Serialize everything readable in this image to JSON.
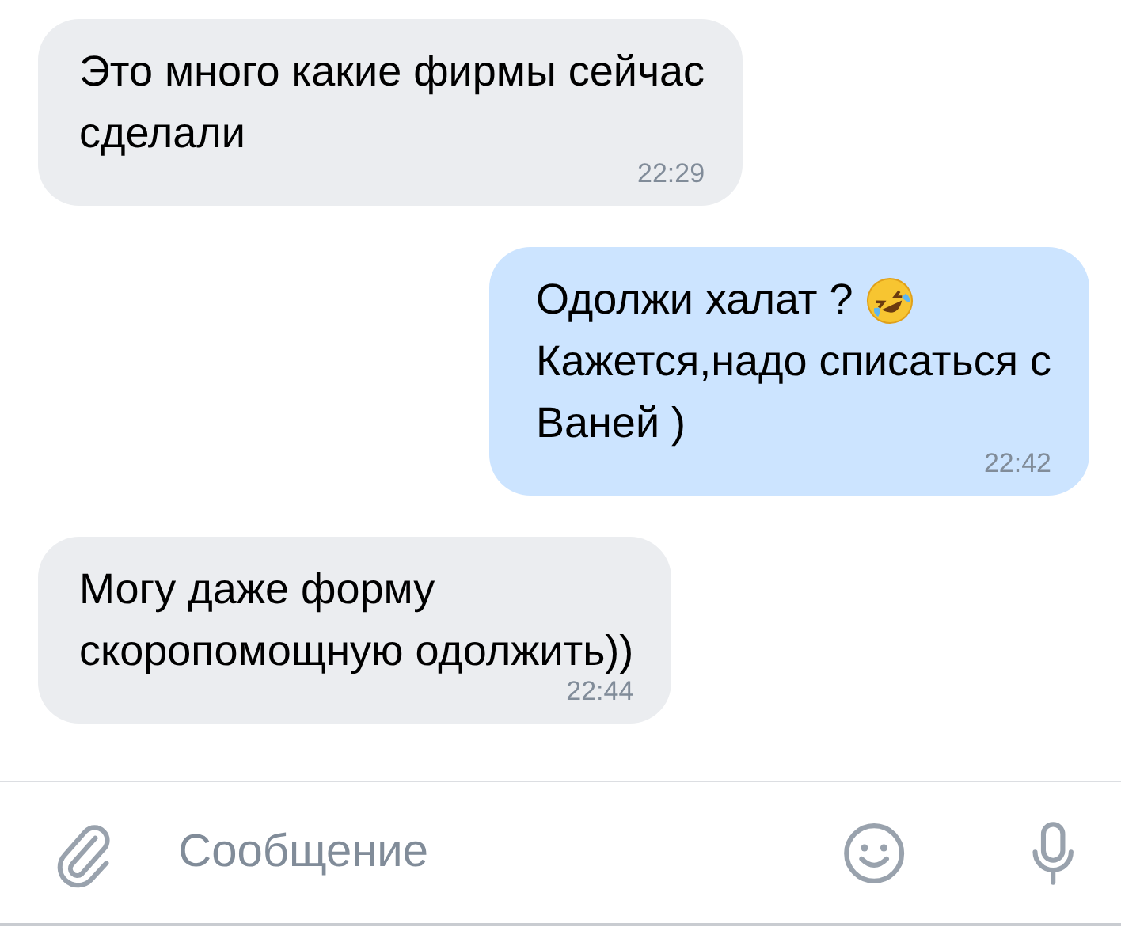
{
  "messages": [
    {
      "kind": "incoming",
      "rows": [
        {
          "text": "Это много какие фирмы сейчас\nсделали"
        }
      ],
      "time": "22:29"
    },
    {
      "kind": "outgoing",
      "rows": [
        {
          "text": "Одолжи халат ?",
          "emoji": true
        },
        {
          "text": "Кажется,надо списаться с\nВаней )"
        }
      ],
      "time": "22:42"
    },
    {
      "kind": "incoming",
      "rows": [
        {
          "text": "Могу даже форму\nскоропомощную одолжить))"
        }
      ],
      "time": "22:44"
    }
  ],
  "composer": {
    "placeholder": "Сообщение"
  }
}
